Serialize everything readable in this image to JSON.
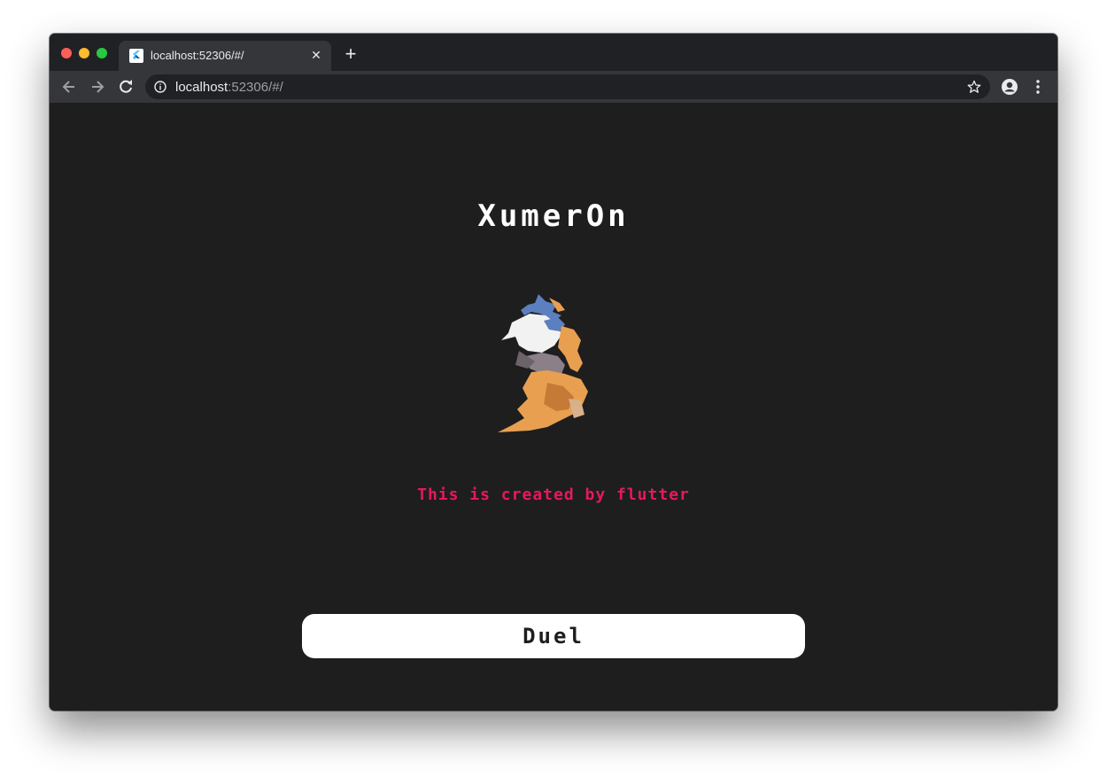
{
  "browser": {
    "tab_title": "localhost:52306/#/",
    "url_host": "localhost",
    "url_rest": ":52306/#/",
    "colors": {
      "tabstrip": "#202124",
      "toolbar": "#35363a",
      "omnibox": "#202124"
    }
  },
  "app": {
    "title": "XumerOn",
    "subtitle": "This is created by flutter",
    "duel_label": "Duel",
    "colors": {
      "background": "#1e1e1f",
      "title": "#ffffff",
      "subtitle": "#e6195a",
      "button": "#ffffff",
      "logo_orange": "#e8a050",
      "logo_blue": "#5b7fbf",
      "logo_white": "#f2f2f2"
    }
  }
}
